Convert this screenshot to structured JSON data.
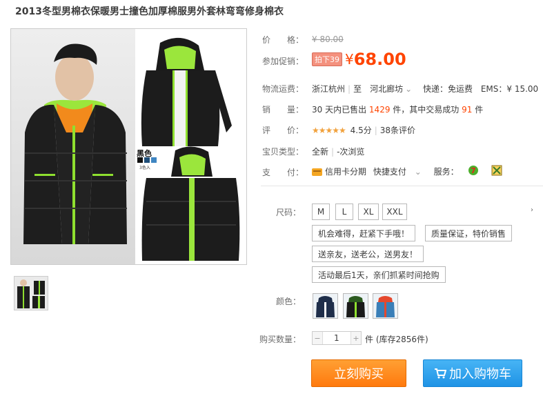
{
  "title": "2013冬型男棉衣保暖男士撞色加厚棉服男外套林弯弯修身棉衣",
  "gallery": {
    "swatch_label": "黑色",
    "swatch_sub": "3色入"
  },
  "price": {
    "label": "价　　格：",
    "original": "¥ 80.00"
  },
  "promotion": {
    "label": "参加促销：",
    "badge": "拍下39",
    "currency": "¥",
    "price": "68.00"
  },
  "shipping": {
    "label": "物流运费：",
    "from": "浙江杭州",
    "to": "至　河北廊坊",
    "express": "快递：免运费",
    "ems": "EMS：¥ 15.00"
  },
  "sales": {
    "label": "销　　量：",
    "prefix": "30 天内已售出",
    "sold": "1429",
    "mid": "件，其中交易成功",
    "success": "91",
    "suffix": "件"
  },
  "rating": {
    "label": "评　　价：",
    "stars_text": "★★★★★",
    "stars_value": 4.5,
    "score": "4.5分",
    "reviews": "38条评价"
  },
  "type": {
    "label": "宝贝类型：",
    "condition": "全新",
    "views": "-次浏览"
  },
  "payment": {
    "label": "支　　付：",
    "installment": "信用卡分期",
    "quickpay": "快捷支付",
    "service_label": "服务："
  },
  "options": {
    "size_label": "尺码：",
    "sizes": [
      "M",
      "L",
      "XL",
      "XXL"
    ],
    "tags": [
      "机会难得，赶紧下手哦！",
      "质量保证，特价销售",
      "送亲友，送老公，送男友！",
      "活动最后1天，亲们抓紧时间抢购"
    ],
    "color_label": "颜色：",
    "colors": [
      "#1f2e4a",
      "#2c5a1f",
      "#3a7fb8"
    ],
    "qty_label": "购买数量：",
    "quantity": "1",
    "unit_stock": "件 (库存2856件)"
  },
  "actions": {
    "buy_now": "立刻购买",
    "add_to_cart": "加入购物车"
  },
  "colors": {
    "accent": "#ff4400",
    "buy": "#ff8a1a",
    "cart": "#2ba0ee"
  }
}
